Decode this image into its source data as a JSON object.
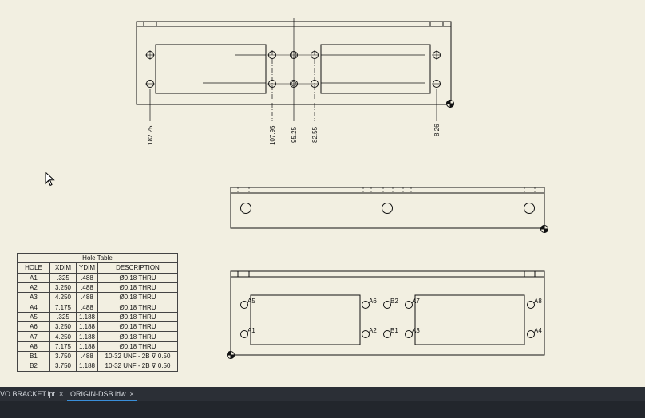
{
  "tabs": [
    {
      "label": "VO BRACKET.ipt",
      "close": "×",
      "active": false
    },
    {
      "label": "ORIGIN-DSB.idw",
      "close": "×",
      "active": true
    }
  ],
  "top_view": {
    "dimensions": [
      "182.25",
      "107.95",
      "95.25",
      "82.55",
      "8.26"
    ]
  },
  "bottom_view": {
    "hole_labels": [
      "A5",
      "A1",
      "A6",
      "A2",
      "B2",
      "B1",
      "A7",
      "A3",
      "A8",
      "A4"
    ]
  },
  "hole_table": {
    "title": "Hole Table",
    "headers": [
      "HOLE",
      "XDIM",
      "YDIM",
      "DESCRIPTION"
    ],
    "rows": [
      [
        "A1",
        ".325",
        ".488",
        "Ø0.18 THRU"
      ],
      [
        "A2",
        "3.250",
        ".488",
        "Ø0.18 THRU"
      ],
      [
        "A3",
        "4.250",
        ".488",
        "Ø0.18 THRU"
      ],
      [
        "A4",
        "7.175",
        ".488",
        "Ø0.18 THRU"
      ],
      [
        "A5",
        ".325",
        "1.188",
        "Ø0.18 THRU"
      ],
      [
        "A6",
        "3.250",
        "1.188",
        "Ø0.18 THRU"
      ],
      [
        "A7",
        "4.250",
        "1.188",
        "Ø0.18 THRU"
      ],
      [
        "A8",
        "7.175",
        "1.188",
        "Ø0.18 THRU"
      ],
      [
        "B1",
        "3.750",
        ".488",
        "10-32 UNF - 2B ⊽ 0.50"
      ],
      [
        "B2",
        "3.750",
        "1.188",
        "10-32 UNF - 2B ⊽ 0.50"
      ]
    ]
  },
  "colors": {
    "sheet": "#f2efe1",
    "line": "#111111",
    "tabbar": "#2b2f36",
    "tab_active_underline": "#3a8fd9"
  }
}
